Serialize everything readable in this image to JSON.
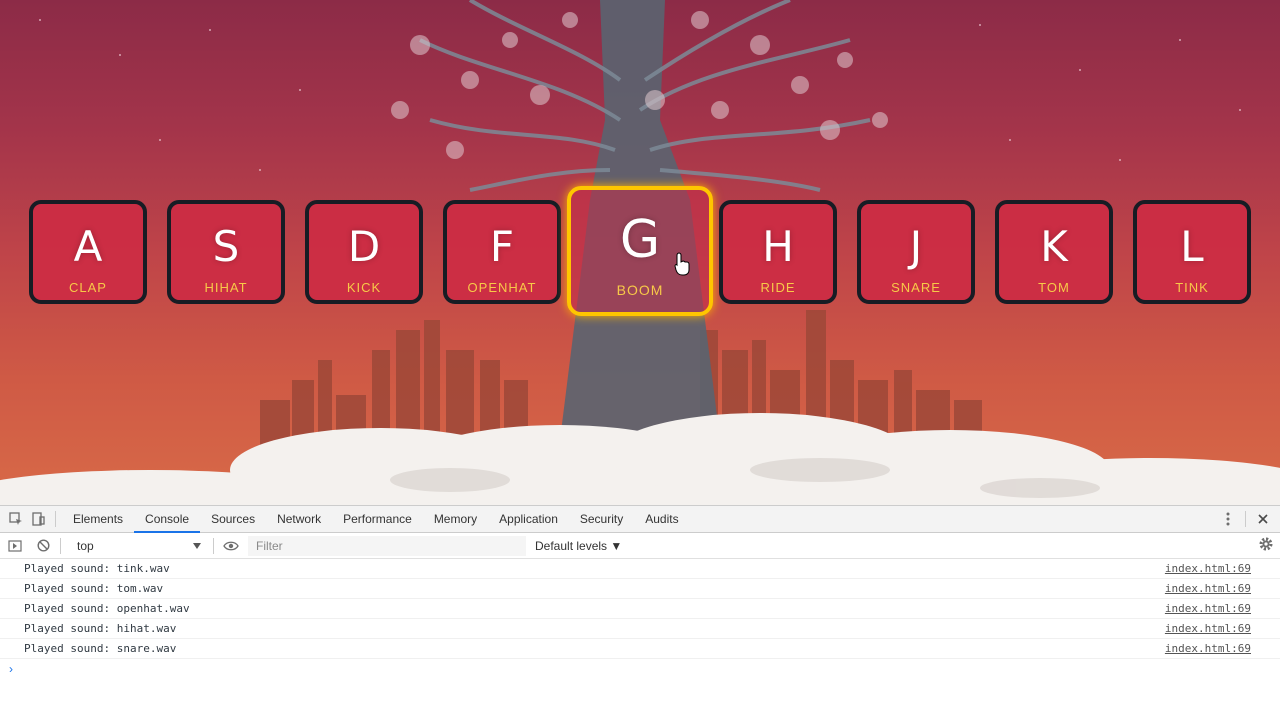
{
  "keys": [
    {
      "letter": "A",
      "sound": "clap",
      "playing": false
    },
    {
      "letter": "S",
      "sound": "hihat",
      "playing": false
    },
    {
      "letter": "D",
      "sound": "kick",
      "playing": false
    },
    {
      "letter": "F",
      "sound": "openhat",
      "playing": false
    },
    {
      "letter": "G",
      "sound": "boom",
      "playing": true
    },
    {
      "letter": "H",
      "sound": "ride",
      "playing": false
    },
    {
      "letter": "J",
      "sound": "snare",
      "playing": false
    },
    {
      "letter": "K",
      "sound": "tom",
      "playing": false
    },
    {
      "letter": "L",
      "sound": "tink",
      "playing": false
    }
  ],
  "devtools": {
    "tabs": [
      "Elements",
      "Console",
      "Sources",
      "Network",
      "Performance",
      "Memory",
      "Application",
      "Security",
      "Audits"
    ],
    "active_tab": "Console",
    "context": "top",
    "filter_placeholder": "Filter",
    "levels": "Default levels ▼",
    "icons": {
      "inspect": "inspect-element-icon",
      "device": "device-toolbar-icon",
      "more": "more-vertical-icon",
      "close": "close-icon",
      "sidebar": "show-sidebar-icon",
      "clear": "clear-console-icon",
      "eye": "live-expression-icon",
      "settings": "gear-icon"
    },
    "console": [
      {
        "message": "Played sound: tink.wav",
        "source": "index.html:69"
      },
      {
        "message": "Played sound: tom.wav",
        "source": "index.html:69"
      },
      {
        "message": "Played sound: openhat.wav",
        "source": "index.html:69"
      },
      {
        "message": "Played sound: hihat.wav",
        "source": "index.html:69"
      },
      {
        "message": "Played sound: snare.wav",
        "source": "index.html:69"
      }
    ],
    "prompt": "›"
  },
  "colors": {
    "accent": "#ffc600",
    "sound_label": "#f7c948",
    "key_bg": "#cc2c44",
    "tab_underline": "#1a73e8"
  }
}
